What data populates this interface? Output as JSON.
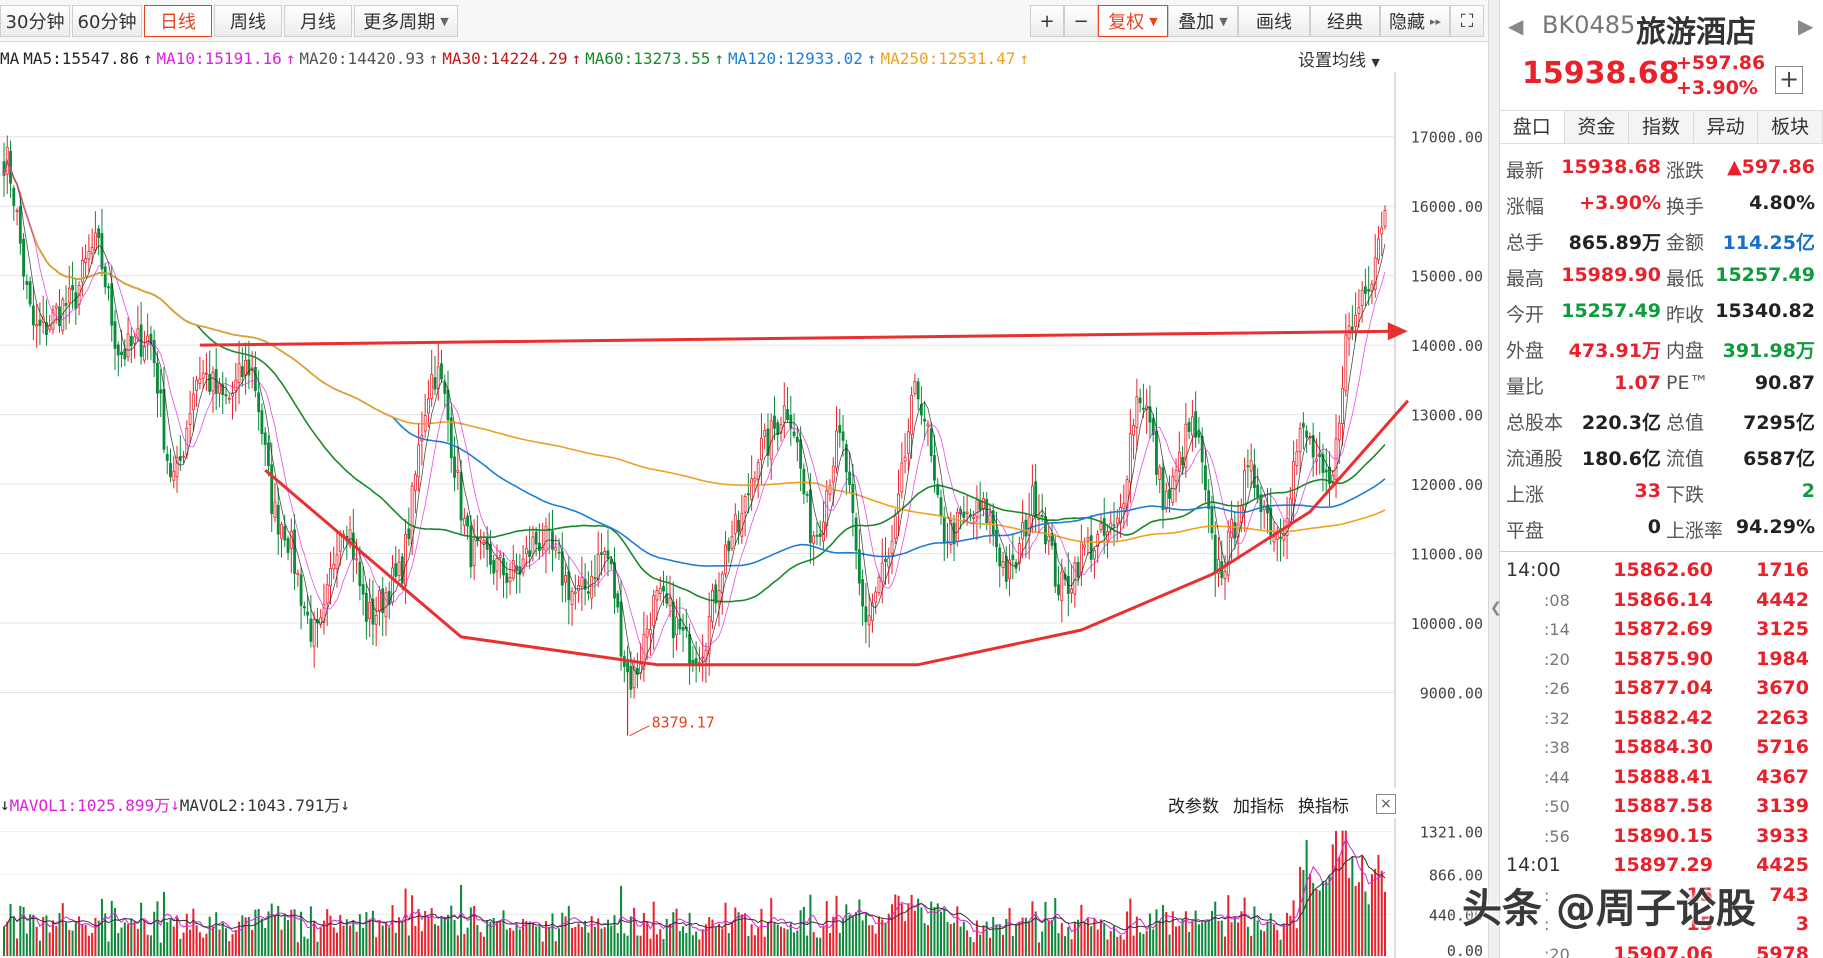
{
  "toolbar": {
    "periods": [
      "30分钟",
      "60分钟",
      "日线",
      "周线",
      "月线",
      "更多周期"
    ],
    "active_period": "日线",
    "tools": [
      "复权",
      "叠加",
      "画线",
      "经典",
      "隐藏"
    ],
    "plus": "+",
    "minus": "−",
    "more_icon": "▸▸",
    "fullscreen_icon": "⛶"
  },
  "ma_bar": {
    "prefix": "MA",
    "items": [
      {
        "label": "MA5:15547.86",
        "color": "#222222"
      },
      {
        "label": "MA10:15191.16",
        "color": "#e020e0"
      },
      {
        "label": "MA20:14420.93",
        "color": "#555555"
      },
      {
        "label": "MA30:14224.29",
        "color": "#c01818"
      },
      {
        "label": "MA60:13273.55",
        "color": "#178a2a"
      },
      {
        "label": "MA120:12933.02",
        "color": "#1c7ed6"
      },
      {
        "label": "MA250:12531.47",
        "color": "#f0a020"
      }
    ],
    "settings": "设置均线"
  },
  "vol_header": {
    "items": [
      {
        "label": "MAVOL1:1025.899万",
        "color": "#e020e0"
      },
      {
        "label": "MAVOL2:1043.791万",
        "color": "#333333"
      }
    ],
    "tools": [
      "改参数",
      "加指标",
      "换指标"
    ],
    "close": "×"
  },
  "panel": {
    "code": "BK0485",
    "name": "旅游酒店",
    "price": "15938.68",
    "change": "+597.86",
    "change_pct": "+3.90%",
    "add": "+",
    "tabs": [
      "盘口",
      "资金",
      "指数",
      "异动",
      "板块"
    ],
    "stats": [
      {
        "l1": "最新",
        "v1": "15938.68",
        "c1": "red",
        "l2": "涨跌",
        "v2": "▲597.86",
        "c2": "red"
      },
      {
        "l1": "涨幅",
        "v1": "+3.90%",
        "c1": "red",
        "l2": "换手",
        "v2": "4.80%",
        "c2": "black"
      },
      {
        "l1": "总手",
        "v1": "865.89万",
        "c1": "black",
        "l2": "金额",
        "v2": "114.25亿",
        "c2": "blue"
      },
      {
        "l1": "最高",
        "v1": "15989.90",
        "c1": "red",
        "l2": "最低",
        "v2": "15257.49",
        "c2": "green"
      },
      {
        "l1": "今开",
        "v1": "15257.49",
        "c1": "green",
        "l2": "昨收",
        "v2": "15340.82",
        "c2": "black"
      },
      {
        "l1": "外盘",
        "v1": "473.91万",
        "c1": "red",
        "l2": "内盘",
        "v2": "391.98万",
        "c2": "green"
      },
      {
        "l1": "量比",
        "v1": "1.07",
        "c1": "red",
        "l2": "PE™",
        "v2": "90.87",
        "c2": "black"
      },
      {
        "l1": "总股本",
        "v1": "220.3亿",
        "c1": "black",
        "l2": "总值",
        "v2": "7295亿",
        "c2": "black"
      },
      {
        "l1": "流通股",
        "v1": "180.6亿",
        "c1": "black",
        "l2": "流值",
        "v2": "6587亿",
        "c2": "black"
      },
      {
        "l1": "上涨",
        "v1": "33",
        "c1": "red",
        "l2": "下跌",
        "v2": "2",
        "c2": "green"
      },
      {
        "l1": "平盘",
        "v1": "0",
        "c1": "black",
        "l2": "上涨率",
        "v2": "94.29%",
        "c2": "black"
      }
    ],
    "ticks": [
      {
        "time": "14:00",
        "kind": "major",
        "price": "15862.60",
        "vol": "1716"
      },
      {
        "time": ":08",
        "kind": "minor",
        "price": "15866.14",
        "vol": "4442"
      },
      {
        "time": ":14",
        "kind": "minor",
        "price": "15872.69",
        "vol": "3125"
      },
      {
        "time": ":20",
        "kind": "minor",
        "price": "15875.90",
        "vol": "1984"
      },
      {
        "time": ":26",
        "kind": "minor",
        "price": "15877.04",
        "vol": "3670"
      },
      {
        "time": ":32",
        "kind": "minor",
        "price": "15882.42",
        "vol": "2263"
      },
      {
        "time": ":38",
        "kind": "minor",
        "price": "15884.30",
        "vol": "5716"
      },
      {
        "time": ":44",
        "kind": "minor",
        "price": "15888.41",
        "vol": "4367"
      },
      {
        "time": ":50",
        "kind": "minor",
        "price": "15887.58",
        "vol": "3139"
      },
      {
        "time": ":56",
        "kind": "minor",
        "price": "15890.15",
        "vol": "3933"
      },
      {
        "time": "14:01",
        "kind": "major",
        "price": "15897.29",
        "vol": "4425"
      },
      {
        "time": ":",
        "kind": "minor",
        "price": "15",
        "vol": "743"
      },
      {
        "time": ":",
        "kind": "minor",
        "price": "15",
        "vol": "3"
      },
      {
        "time": ":20",
        "kind": "minor",
        "price": "15907.06",
        "vol": "5978"
      }
    ]
  },
  "watermark": "头条 @周子论股",
  "chart_data": {
    "type": "candlestick",
    "y_ticks": [
      "17000.00",
      "16000.00",
      "15000.00",
      "14000.00",
      "13000.00",
      "12000.00",
      "11000.00",
      "10000.00",
      "9000.00"
    ],
    "ylim": [
      8000,
      17500
    ],
    "low_label": "8379.17",
    "anchors": [
      [
        0,
        16700
      ],
      [
        10,
        14200
      ],
      [
        20,
        14600
      ],
      [
        28,
        15400
      ],
      [
        36,
        13900
      ],
      [
        44,
        14100
      ],
      [
        52,
        12100
      ],
      [
        60,
        13600
      ],
      [
        68,
        13200
      ],
      [
        75,
        13700
      ],
      [
        84,
        11500
      ],
      [
        96,
        9800
      ],
      [
        104,
        11500
      ],
      [
        112,
        10100
      ],
      [
        120,
        10600
      ],
      [
        132,
        13600
      ],
      [
        144,
        11000
      ],
      [
        156,
        10700
      ],
      [
        164,
        11200
      ],
      [
        176,
        10400
      ],
      [
        184,
        11000
      ],
      [
        192,
        9200
      ],
      [
        200,
        10300
      ],
      [
        212,
        9600
      ],
      [
        224,
        11300
      ],
      [
        232,
        12500
      ],
      [
        240,
        13100
      ],
      [
        248,
        11300
      ],
      [
        256,
        12600
      ],
      [
        264,
        10100
      ],
      [
        270,
        10800
      ],
      [
        280,
        13300
      ],
      [
        288,
        11300
      ],
      [
        300,
        11600
      ],
      [
        308,
        10700
      ],
      [
        316,
        11800
      ],
      [
        324,
        10500
      ],
      [
        332,
        11100
      ],
      [
        340,
        11300
      ],
      [
        348,
        13300
      ],
      [
        356,
        11800
      ],
      [
        364,
        12800
      ],
      [
        372,
        10800
      ],
      [
        382,
        12100
      ],
      [
        390,
        11300
      ],
      [
        398,
        12700
      ],
      [
        406,
        11900
      ],
      [
        412,
        14200
      ],
      [
        418,
        15000
      ],
      [
        423,
        15939
      ]
    ],
    "ma_overlays": [
      {
        "label": "MA60",
        "color": "#178a2a"
      },
      {
        "label": "MA120",
        "color": "#1c7ed6"
      },
      {
        "label": "MA250",
        "color": "#f0a020"
      }
    ],
    "annotations": {
      "resistance_line": {
        "from": [
          60,
          14000
        ],
        "to": [
          430,
          14200
        ]
      },
      "bowl_bottom": [
        [
          80,
          12200
        ],
        [
          140,
          9800
        ],
        [
          200,
          9400
        ],
        [
          280,
          9400
        ],
        [
          330,
          9900
        ],
        [
          370,
          10700
        ],
        [
          400,
          11600
        ],
        [
          430,
          13200
        ]
      ]
    },
    "volume": {
      "y_ticks": [
        "1321.00",
        "866.00",
        "440.00",
        "0.00"
      ],
      "ylim": [
        0,
        1400
      ]
    }
  }
}
